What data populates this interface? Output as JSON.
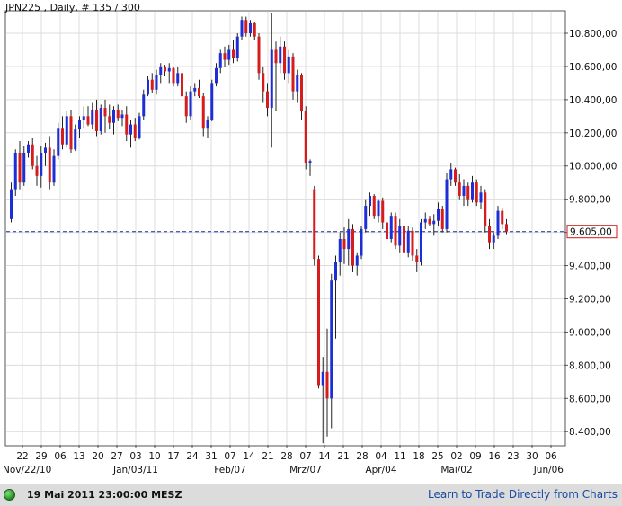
{
  "header": {
    "title": "JPN225 , Daily, # 135 / 300"
  },
  "footer": {
    "datetime": "19 Mai 2011 23:00:00 MESZ",
    "link": "Learn to Trade Directly from Charts"
  },
  "colors": {
    "up": "#1c2fd6",
    "down": "#d61c1c",
    "grid": "#dcdcdc",
    "price_line": "#1a2a9a"
  },
  "chart_data": {
    "type": "candlestick",
    "title": "JPN225 , Daily, # 135 / 300",
    "symbol": "JPN225",
    "period": "Daily",
    "ylim": [
      8320,
      10930
    ],
    "y_ticks": [
      "10.800,00",
      "10.600,00",
      "10.400,00",
      "10.200,00",
      "10.000,00",
      "9.800,00",
      "9.600,00",
      "9.400,00",
      "9.200,00",
      "9.000,00",
      "8.800,00",
      "8.600,00",
      "8.400,00"
    ],
    "y_tick_values": [
      10800,
      10600,
      10400,
      10200,
      10000,
      9800,
      9600,
      9400,
      9200,
      9000,
      8800,
      8600,
      8400
    ],
    "x_day_labels": [
      "22",
      "29",
      "06",
      "13",
      "20",
      "27",
      "03",
      "10",
      "17",
      "24",
      "31",
      "07",
      "14",
      "21",
      "28",
      "07",
      "14",
      "21",
      "28",
      "04",
      "11",
      "18",
      "25",
      "02",
      "09",
      "16",
      "23",
      "30",
      "06"
    ],
    "x_month_labels": [
      {
        "label": "Nov/22/10",
        "index": 0
      },
      {
        "label": "Jan/03/11",
        "index": 6
      },
      {
        "label": "Feb/07",
        "index": 11
      },
      {
        "label": "Mrz/07",
        "index": 15
      },
      {
        "label": "Apr/04",
        "index": 19
      },
      {
        "label": "Mai/02",
        "index": 23
      },
      {
        "label": "Jun/06",
        "index": 28
      }
    ],
    "current_price": 9605,
    "current_price_label": "9.605,00",
    "candles": [
      {
        "o": 9680,
        "h": 9900,
        "l": 9660,
        "c": 9860
      },
      {
        "o": 9860,
        "h": 10100,
        "l": 9820,
        "c": 10080
      },
      {
        "o": 10080,
        "h": 10150,
        "l": 9860,
        "c": 9900
      },
      {
        "o": 9900,
        "h": 10120,
        "l": 9880,
        "c": 10080
      },
      {
        "o": 10080,
        "h": 10150,
        "l": 10050,
        "c": 10130
      },
      {
        "o": 10130,
        "h": 10170,
        "l": 9980,
        "c": 10000
      },
      {
        "o": 10000,
        "h": 10060,
        "l": 9880,
        "c": 9940
      },
      {
        "o": 9940,
        "h": 10120,
        "l": 9870,
        "c": 10080
      },
      {
        "o": 10080,
        "h": 10140,
        "l": 10000,
        "c": 10110
      },
      {
        "o": 10110,
        "h": 10180,
        "l": 9860,
        "c": 9900
      },
      {
        "o": 9900,
        "h": 10100,
        "l": 9880,
        "c": 10060
      },
      {
        "o": 10060,
        "h": 10260,
        "l": 10040,
        "c": 10230
      },
      {
        "o": 10230,
        "h": 10300,
        "l": 10100,
        "c": 10130
      },
      {
        "o": 10130,
        "h": 10330,
        "l": 10110,
        "c": 10300
      },
      {
        "o": 10300,
        "h": 10340,
        "l": 10080,
        "c": 10100
      },
      {
        "o": 10100,
        "h": 10250,
        "l": 10090,
        "c": 10220
      },
      {
        "o": 10220,
        "h": 10300,
        "l": 10170,
        "c": 10280
      },
      {
        "o": 10280,
        "h": 10360,
        "l": 10230,
        "c": 10300
      },
      {
        "o": 10300,
        "h": 10360,
        "l": 10240,
        "c": 10250
      },
      {
        "o": 10250,
        "h": 10380,
        "l": 10220,
        "c": 10340
      },
      {
        "o": 10340,
        "h": 10400,
        "l": 10180,
        "c": 10210
      },
      {
        "o": 10210,
        "h": 10370,
        "l": 10190,
        "c": 10350
      },
      {
        "o": 10350,
        "h": 10400,
        "l": 10200,
        "c": 10300
      },
      {
        "o": 10300,
        "h": 10370,
        "l": 10220,
        "c": 10260
      },
      {
        "o": 10260,
        "h": 10360,
        "l": 10190,
        "c": 10340
      },
      {
        "o": 10340,
        "h": 10370,
        "l": 10270,
        "c": 10290
      },
      {
        "o": 10290,
        "h": 10340,
        "l": 10240,
        "c": 10310
      },
      {
        "o": 10310,
        "h": 10360,
        "l": 10150,
        "c": 10190
      },
      {
        "o": 10190,
        "h": 10280,
        "l": 10110,
        "c": 10250
      },
      {
        "o": 10250,
        "h": 10290,
        "l": 10150,
        "c": 10170
      },
      {
        "o": 10170,
        "h": 10320,
        "l": 10160,
        "c": 10300
      },
      {
        "o": 10300,
        "h": 10460,
        "l": 10280,
        "c": 10430
      },
      {
        "o": 10430,
        "h": 10540,
        "l": 10420,
        "c": 10520
      },
      {
        "o": 10520,
        "h": 10560,
        "l": 10440,
        "c": 10460
      },
      {
        "o": 10460,
        "h": 10580,
        "l": 10430,
        "c": 10550
      },
      {
        "o": 10550,
        "h": 10620,
        "l": 10500,
        "c": 10600
      },
      {
        "o": 10600,
        "h": 10610,
        "l": 10540,
        "c": 10570
      },
      {
        "o": 10570,
        "h": 10620,
        "l": 10500,
        "c": 10590
      },
      {
        "o": 10590,
        "h": 10600,
        "l": 10480,
        "c": 10500
      },
      {
        "o": 10500,
        "h": 10600,
        "l": 10480,
        "c": 10560
      },
      {
        "o": 10560,
        "h": 10570,
        "l": 10400,
        "c": 10420
      },
      {
        "o": 10420,
        "h": 10450,
        "l": 10260,
        "c": 10300
      },
      {
        "o": 10300,
        "h": 10480,
        "l": 10280,
        "c": 10450
      },
      {
        "o": 10450,
        "h": 10500,
        "l": 10420,
        "c": 10470
      },
      {
        "o": 10470,
        "h": 10520,
        "l": 10410,
        "c": 10420
      },
      {
        "o": 10420,
        "h": 10440,
        "l": 10180,
        "c": 10230
      },
      {
        "o": 10230,
        "h": 10300,
        "l": 10170,
        "c": 10280
      },
      {
        "o": 10280,
        "h": 10520,
        "l": 10270,
        "c": 10500
      },
      {
        "o": 10500,
        "h": 10620,
        "l": 10480,
        "c": 10590
      },
      {
        "o": 10590,
        "h": 10700,
        "l": 10560,
        "c": 10680
      },
      {
        "o": 10680,
        "h": 10720,
        "l": 10600,
        "c": 10640
      },
      {
        "o": 10640,
        "h": 10730,
        "l": 10610,
        "c": 10700
      },
      {
        "o": 10700,
        "h": 10760,
        "l": 10620,
        "c": 10650
      },
      {
        "o": 10650,
        "h": 10800,
        "l": 10630,
        "c": 10780
      },
      {
        "o": 10780,
        "h": 10900,
        "l": 10760,
        "c": 10880
      },
      {
        "o": 10880,
        "h": 10900,
        "l": 10780,
        "c": 10800
      },
      {
        "o": 10800,
        "h": 10880,
        "l": 10780,
        "c": 10860
      },
      {
        "o": 10860,
        "h": 10870,
        "l": 10760,
        "c": 10780
      },
      {
        "o": 10780,
        "h": 10800,
        "l": 10520,
        "c": 10560
      },
      {
        "o": 10560,
        "h": 10600,
        "l": 10380,
        "c": 10450
      },
      {
        "o": 10450,
        "h": 10500,
        "l": 10300,
        "c": 10350
      },
      {
        "o": 10350,
        "h": 10920,
        "l": 10110,
        "c": 10700
      },
      {
        "o": 10700,
        "h": 10750,
        "l": 10330,
        "c": 10620
      },
      {
        "o": 10620,
        "h": 10780,
        "l": 10560,
        "c": 10720
      },
      {
        "o": 10720,
        "h": 10750,
        "l": 10520,
        "c": 10560
      },
      {
        "o": 10560,
        "h": 10700,
        "l": 10500,
        "c": 10660
      },
      {
        "o": 10660,
        "h": 10680,
        "l": 10400,
        "c": 10450
      },
      {
        "o": 10450,
        "h": 10580,
        "l": 10380,
        "c": 10550
      },
      {
        "o": 10550,
        "h": 10560,
        "l": 10280,
        "c": 10330
      },
      {
        "o": 10330,
        "h": 10360,
        "l": 9980,
        "c": 10020
      },
      {
        "o": 10020,
        "h": 10040,
        "l": 9940,
        "c": 10030
      },
      {
        "o": 9860,
        "h": 9880,
        "l": 9400,
        "c": 9440
      },
      {
        "o": 9440,
        "h": 9460,
        "l": 8660,
        "c": 8680
      },
      {
        "o": 8680,
        "h": 8850,
        "l": 8330,
        "c": 8760
      },
      {
        "o": 8760,
        "h": 9020,
        "l": 8370,
        "c": 8600
      },
      {
        "o": 8600,
        "h": 9350,
        "l": 8420,
        "c": 9310
      },
      {
        "o": 9310,
        "h": 9460,
        "l": 8960,
        "c": 9420
      },
      {
        "o": 9420,
        "h": 9600,
        "l": 9340,
        "c": 9560
      },
      {
        "o": 9560,
        "h": 9630,
        "l": 9410,
        "c": 9500
      },
      {
        "o": 9500,
        "h": 9680,
        "l": 9400,
        "c": 9620
      },
      {
        "o": 9620,
        "h": 9650,
        "l": 9360,
        "c": 9400
      },
      {
        "o": 9400,
        "h": 9480,
        "l": 9340,
        "c": 9460
      },
      {
        "o": 9460,
        "h": 9640,
        "l": 9440,
        "c": 9620
      },
      {
        "o": 9620,
        "h": 9800,
        "l": 9600,
        "c": 9760
      },
      {
        "o": 9760,
        "h": 9840,
        "l": 9700,
        "c": 9820
      },
      {
        "o": 9820,
        "h": 9830,
        "l": 9680,
        "c": 9700
      },
      {
        "o": 9700,
        "h": 9800,
        "l": 9660,
        "c": 9790
      },
      {
        "o": 9790,
        "h": 9810,
        "l": 9620,
        "c": 9660
      },
      {
        "o": 9660,
        "h": 9720,
        "l": 9400,
        "c": 9560
      },
      {
        "o": 9560,
        "h": 9720,
        "l": 9540,
        "c": 9700
      },
      {
        "o": 9700,
        "h": 9720,
        "l": 9500,
        "c": 9520
      },
      {
        "o": 9520,
        "h": 9680,
        "l": 9480,
        "c": 9640
      },
      {
        "o": 9640,
        "h": 9660,
        "l": 9440,
        "c": 9480
      },
      {
        "o": 9480,
        "h": 9640,
        "l": 9450,
        "c": 9610
      },
      {
        "o": 9610,
        "h": 9630,
        "l": 9430,
        "c": 9460
      },
      {
        "o": 9460,
        "h": 9500,
        "l": 9360,
        "c": 9420
      },
      {
        "o": 9420,
        "h": 9680,
        "l": 9400,
        "c": 9660
      },
      {
        "o": 9660,
        "h": 9720,
        "l": 9620,
        "c": 9680
      },
      {
        "o": 9680,
        "h": 9700,
        "l": 9640,
        "c": 9650
      },
      {
        "o": 9650,
        "h": 9710,
        "l": 9580,
        "c": 9670
      },
      {
        "o": 9670,
        "h": 9780,
        "l": 9640,
        "c": 9740
      },
      {
        "o": 9740,
        "h": 9760,
        "l": 9600,
        "c": 9620
      },
      {
        "o": 9620,
        "h": 9960,
        "l": 9600,
        "c": 9920
      },
      {
        "o": 9920,
        "h": 10020,
        "l": 9880,
        "c": 9980
      },
      {
        "o": 9980,
        "h": 9990,
        "l": 9880,
        "c": 9900
      },
      {
        "o": 9900,
        "h": 9950,
        "l": 9800,
        "c": 9820
      },
      {
        "o": 9820,
        "h": 9920,
        "l": 9760,
        "c": 9880
      },
      {
        "o": 9880,
        "h": 9900,
        "l": 9760,
        "c": 9800
      },
      {
        "o": 9800,
        "h": 9940,
        "l": 9780,
        "c": 9900
      },
      {
        "o": 9900,
        "h": 9920,
        "l": 9760,
        "c": 9780
      },
      {
        "o": 9780,
        "h": 9880,
        "l": 9740,
        "c": 9840
      },
      {
        "o": 9840,
        "h": 9860,
        "l": 9600,
        "c": 9640
      },
      {
        "o": 9640,
        "h": 9680,
        "l": 9500,
        "c": 9540
      },
      {
        "o": 9540,
        "h": 9600,
        "l": 9500,
        "c": 9580
      },
      {
        "o": 9580,
        "h": 9760,
        "l": 9560,
        "c": 9730
      },
      {
        "o": 9730,
        "h": 9750,
        "l": 9620,
        "c": 9650
      },
      {
        "o": 9650,
        "h": 9680,
        "l": 9590,
        "c": 9605
      }
    ]
  }
}
